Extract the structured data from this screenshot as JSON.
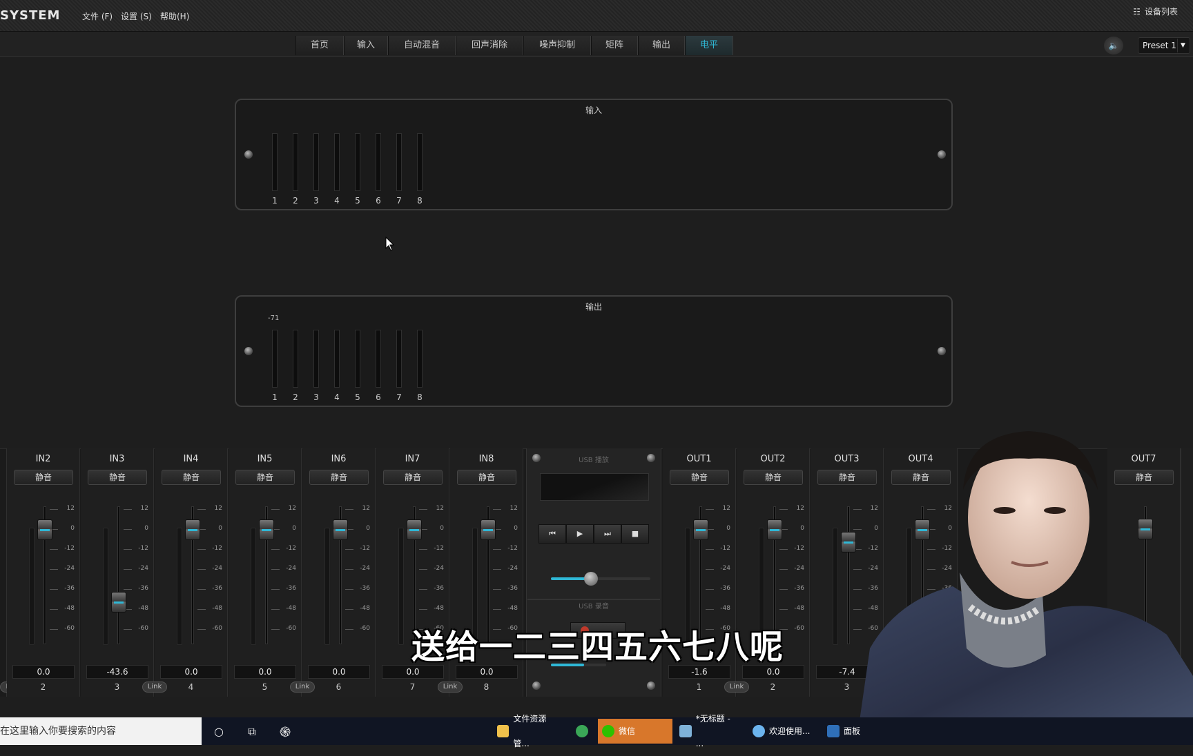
{
  "app": {
    "logo": "SYSTEM",
    "menus": [
      "文件 (F)",
      "设置 (S)",
      "帮助(H)"
    ],
    "device_list": "设备列表"
  },
  "tabs": [
    {
      "label": "首页",
      "active": false
    },
    {
      "label": "输入",
      "active": false
    },
    {
      "label": "自动混音",
      "active": false
    },
    {
      "label": "回声消除",
      "active": false
    },
    {
      "label": "噪声抑制",
      "active": false
    },
    {
      "label": "矩阵",
      "active": false
    },
    {
      "label": "输出",
      "active": false
    },
    {
      "label": "电平",
      "active": true
    }
  ],
  "preset": "Preset 1",
  "input_panel": {
    "title": "输入",
    "channels": [
      "1",
      "2",
      "3",
      "4",
      "5",
      "6",
      "7",
      "8"
    ]
  },
  "output_panel": {
    "title": "输出",
    "peak_label": "-71",
    "channels": [
      "1",
      "2",
      "3",
      "4",
      "5",
      "6",
      "7",
      "8"
    ]
  },
  "mute_label": "静音",
  "link_label": "Link",
  "scale": [
    "12",
    "0",
    "-12",
    "-24",
    "-36",
    "-48",
    "-60"
  ],
  "input_strips": [
    {
      "name": "IN2",
      "value": "0.0",
      "num": "2",
      "fader_db": 0,
      "link": false
    },
    {
      "name": "IN3",
      "value": "-43.6",
      "num": "3",
      "fader_db": -43.6,
      "link": false
    },
    {
      "name": "IN4",
      "value": "0.0",
      "num": "4",
      "fader_db": 0,
      "link": true
    },
    {
      "name": "IN5",
      "value": "0.0",
      "num": "5",
      "fader_db": 0,
      "link": false
    },
    {
      "name": "IN6",
      "value": "0.0",
      "num": "6",
      "fader_db": 0,
      "link": true
    },
    {
      "name": "IN7",
      "value": "0.0",
      "num": "7",
      "fader_db": 0,
      "link": false
    },
    {
      "name": "IN8",
      "value": "0.0",
      "num": "8",
      "fader_db": 0,
      "link": true
    }
  ],
  "output_strips": [
    {
      "name": "OUT1",
      "value": "-1.6",
      "num": "1",
      "fader_db": 0,
      "link": false
    },
    {
      "name": "OUT2",
      "value": "0.0",
      "num": "2",
      "fader_db": 0,
      "link": true
    },
    {
      "name": "OUT3",
      "value": "-7.4",
      "num": "3",
      "fader_db": -7.4,
      "link": false
    },
    {
      "name": "OUT4",
      "value": "",
      "num": "",
      "fader_db": 0,
      "link": false
    }
  ],
  "out7": {
    "name": "OUT7"
  },
  "first_link": "Link",
  "usb": {
    "play_title": "USB 播放",
    "record_title": "USB 录音",
    "volume": 0.4
  },
  "taskbar": {
    "search_placeholder": "在这里输入你要搜索的内容",
    "apps": [
      "文件资源管...",
      "微信",
      "*无标题 - ...",
      "欢迎使用...",
      "面板"
    ]
  },
  "subtitle": "送给一二三四五六七八呢",
  "colors": {
    "accent": "#2fb8d6",
    "wechat": "#d8772b"
  }
}
